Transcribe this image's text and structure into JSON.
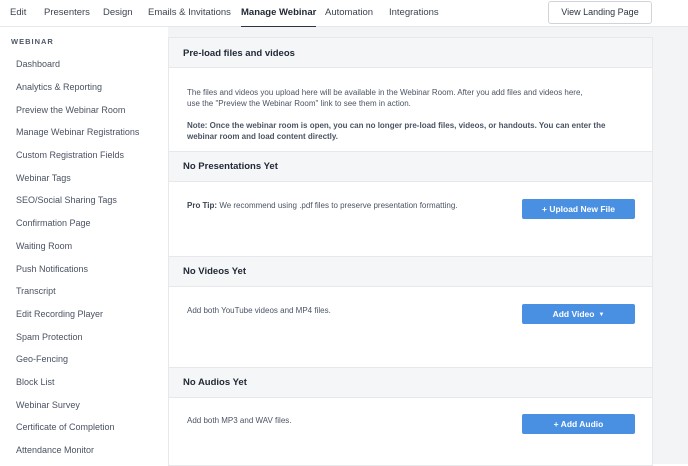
{
  "topnav": {
    "tabs": [
      {
        "label": "Edit"
      },
      {
        "label": "Presenters"
      },
      {
        "label": "Design"
      },
      {
        "label": "Emails & Invitations"
      },
      {
        "label": "Manage Webinar"
      },
      {
        "label": "Automation"
      },
      {
        "label": "Integrations"
      }
    ],
    "active_tab": "Manage Webinar",
    "landing_button": "View Landing Page"
  },
  "sidebar": {
    "heading": "WEBINAR",
    "items": [
      {
        "label": "Dashboard"
      },
      {
        "label": "Analytics & Reporting"
      },
      {
        "label": "Preview the Webinar Room"
      },
      {
        "label": "Manage Webinar Registrations"
      },
      {
        "label": "Custom Registration Fields"
      },
      {
        "label": "Webinar Tags"
      },
      {
        "label": "SEO/Social Sharing Tags"
      },
      {
        "label": "Confirmation Page"
      },
      {
        "label": "Waiting Room"
      },
      {
        "label": "Push Notifications"
      },
      {
        "label": "Transcript"
      },
      {
        "label": "Edit Recording Player"
      },
      {
        "label": "Spam Protection"
      },
      {
        "label": "Geo-Fencing"
      },
      {
        "label": "Block List"
      },
      {
        "label": "Webinar Survey"
      },
      {
        "label": "Certificate of Completion"
      },
      {
        "label": "Attendance Monitor"
      }
    ]
  },
  "main": {
    "title": "Pre-load files and videos",
    "intro_line1": "The files and videos you upload here will be available in the Webinar Room. After you add files and videos here,",
    "intro_line2": "use the \"Preview the Webinar Room\" link to see them in action.",
    "note_line1": "Note: Once the webinar room is open, you can no longer pre-load files, videos, or handouts. You can enter the",
    "note_line2": "webinar room and load content directly.",
    "presentations": {
      "header": "No Presentations Yet",
      "tip_label": "Pro Tip:",
      "tip_text": "We recommend using .pdf files to preserve presentation formatting.",
      "button": "+ Upload New File"
    },
    "videos": {
      "header": "No Videos Yet",
      "text": "Add both YouTube videos and MP4 files.",
      "button": "Add Video",
      "button_caret": "▼"
    },
    "audios": {
      "header": "No Audios Yet",
      "text": "Add both MP3 and WAV files.",
      "button": "+ Add Audio"
    }
  },
  "colors": {
    "primary_button": "#4a90e2",
    "section_header_bg": "#f5f6f8",
    "main_bg": "#f3f4f6"
  }
}
